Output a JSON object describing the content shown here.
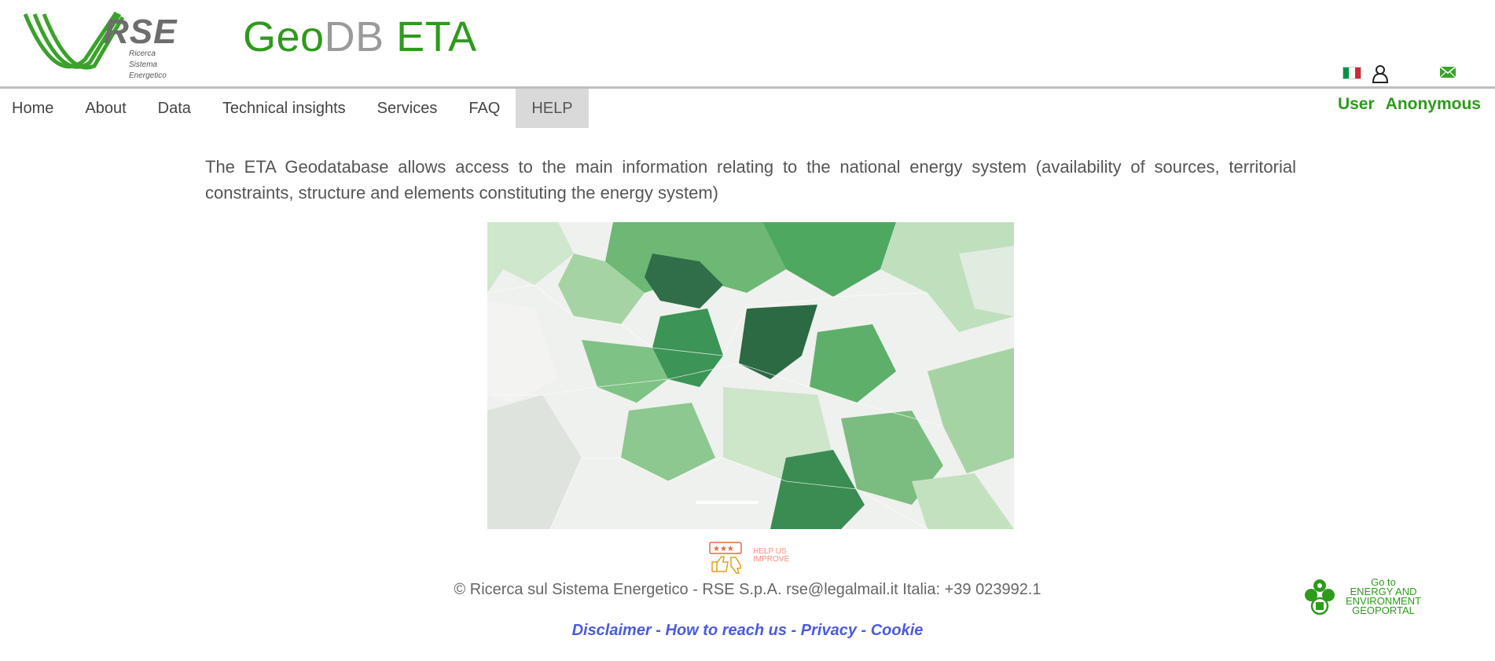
{
  "header": {
    "logo": {
      "brand": "RSE",
      "subtitle_lines": [
        "Ricerca",
        "Sistema",
        "Energetico"
      ]
    },
    "title_parts": [
      "Geo",
      "DB",
      " ETA"
    ],
    "flag_colors": [
      "#009246",
      "#ffffff",
      "#ce2b37"
    ],
    "icons": [
      "italian-flag-icon",
      "user-icon",
      "mail-icon"
    ]
  },
  "nav": {
    "items": [
      "Home",
      "About",
      "Data",
      "Technical insights",
      "Services",
      "FAQ",
      "HELP"
    ],
    "active_index": 6
  },
  "user": {
    "label": "User",
    "name": "Anonymous"
  },
  "intro": "The ETA Geodatabase allows access to the main information relating to the national energy system (availability of sources, territorial constraints, structure and elements constituting the energy system)",
  "help_improve": {
    "text_lines": [
      "HELP US",
      "IMPROVE"
    ]
  },
  "footer": {
    "copyright": "© Ricerca sul Sistema Energetico - RSE S.p.A. rse@legalmail.it Italia: +39 023992.1",
    "links": [
      "Disclaimer",
      "How to reach us",
      "Privacy",
      "Cookie"
    ],
    "separator": " - ",
    "geoportal_lines": [
      "Go to",
      "ENERGY AND",
      "ENVIRONMENT",
      "GEOPORTAL"
    ]
  },
  "colors": {
    "brand_green": "#2e9a1c",
    "link_blue": "#4b5bdc",
    "nav_active_bg": "#d9d9d9"
  }
}
